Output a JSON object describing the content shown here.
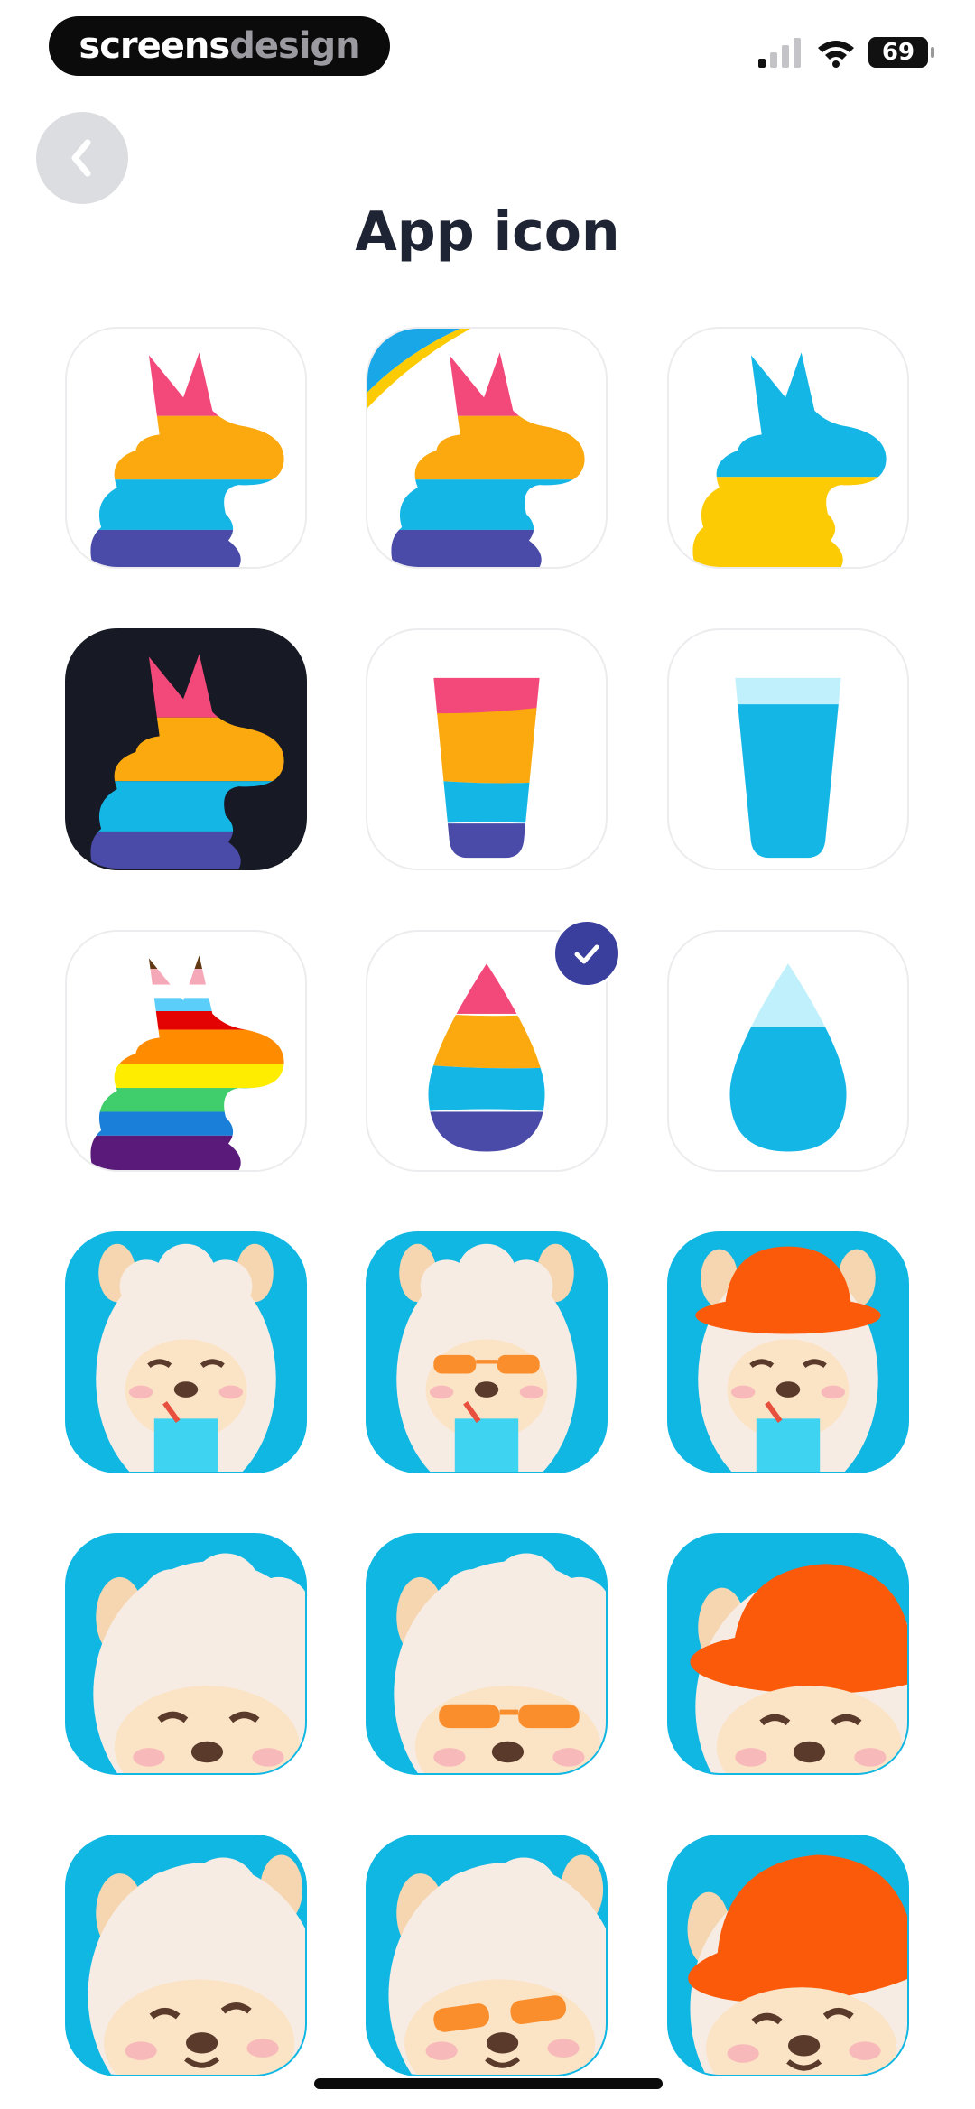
{
  "status_bar": {
    "brand_part1": "screens",
    "brand_part2": "design",
    "battery": "69"
  },
  "header": {
    "back_icon": "chevron-left-icon",
    "title": "App icon"
  },
  "colors": {
    "accent": "#3a3e9c",
    "pink": "#f2487a",
    "orange": "#fba90e",
    "cyan": "#14b6e6",
    "indigo": "#4a4aa8",
    "yellow": "#fccb03",
    "tile_blue": "#10b7e2",
    "dark": "#171a24"
  },
  "icons": [
    {
      "name": "llama-rainbow",
      "selected": false
    },
    {
      "name": "llama-rainbow-ukraine",
      "selected": false
    },
    {
      "name": "llama-blue-yellow",
      "selected": false
    },
    {
      "name": "llama-rainbow-dark",
      "selected": false
    },
    {
      "name": "glass-rainbow",
      "selected": false
    },
    {
      "name": "glass-blue",
      "selected": false
    },
    {
      "name": "llama-pride",
      "selected": false
    },
    {
      "name": "drop-rainbow",
      "selected": true
    },
    {
      "name": "drop-blue",
      "selected": false
    },
    {
      "name": "alpaca-drink",
      "selected": false
    },
    {
      "name": "alpaca-drink-glasses",
      "selected": false
    },
    {
      "name": "alpaca-drink-hat",
      "selected": false
    },
    {
      "name": "alpaca-closeup",
      "selected": false
    },
    {
      "name": "alpaca-closeup-glasses",
      "selected": false
    },
    {
      "name": "alpaca-closeup-hat",
      "selected": false
    },
    {
      "name": "alpaca-tilt",
      "selected": false
    },
    {
      "name": "alpaca-tilt-glasses",
      "selected": false
    },
    {
      "name": "alpaca-tilt-hat",
      "selected": false
    }
  ]
}
